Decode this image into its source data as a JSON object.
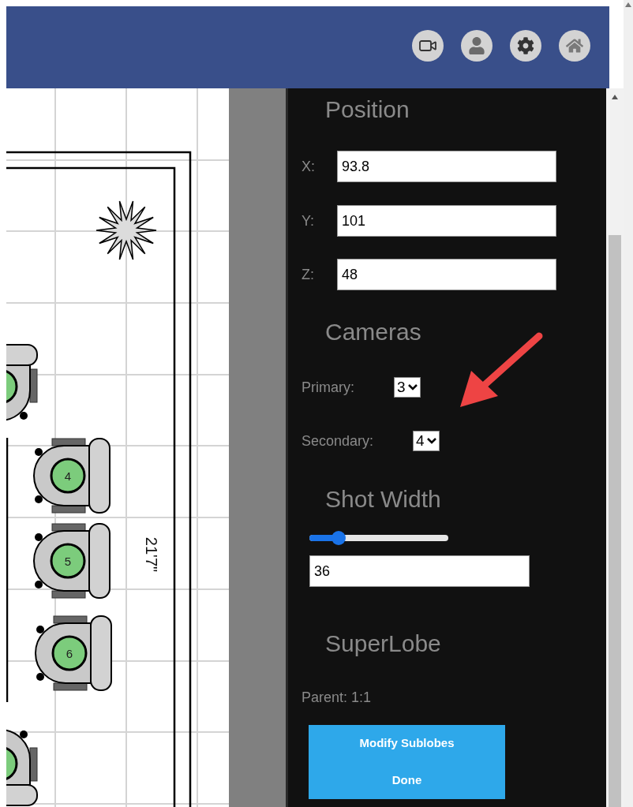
{
  "canvas": {
    "seats": [
      {
        "number": "4"
      },
      {
        "number": "5"
      },
      {
        "number": "6"
      }
    ],
    "dimension": "21'7\""
  },
  "panel": {
    "position": {
      "heading": "Position",
      "fields": [
        {
          "label": "X:",
          "value": "93.8"
        },
        {
          "label": "Y:",
          "value": "101"
        },
        {
          "label": "Z:",
          "value": "48"
        }
      ]
    },
    "cameras": {
      "heading": "Cameras",
      "selects": [
        {
          "label": "Primary:",
          "value": "3"
        },
        {
          "label": "Secondary:",
          "value": "4"
        }
      ]
    },
    "shot_width": {
      "heading": "Shot Width",
      "slider": {
        "level": 0.21
      },
      "value": "36"
    },
    "superlobe": {
      "heading": "SuperLobe",
      "parent": "Parent: 1:1",
      "buttons": [
        "Modify Sublobes",
        "Done"
      ]
    }
  }
}
